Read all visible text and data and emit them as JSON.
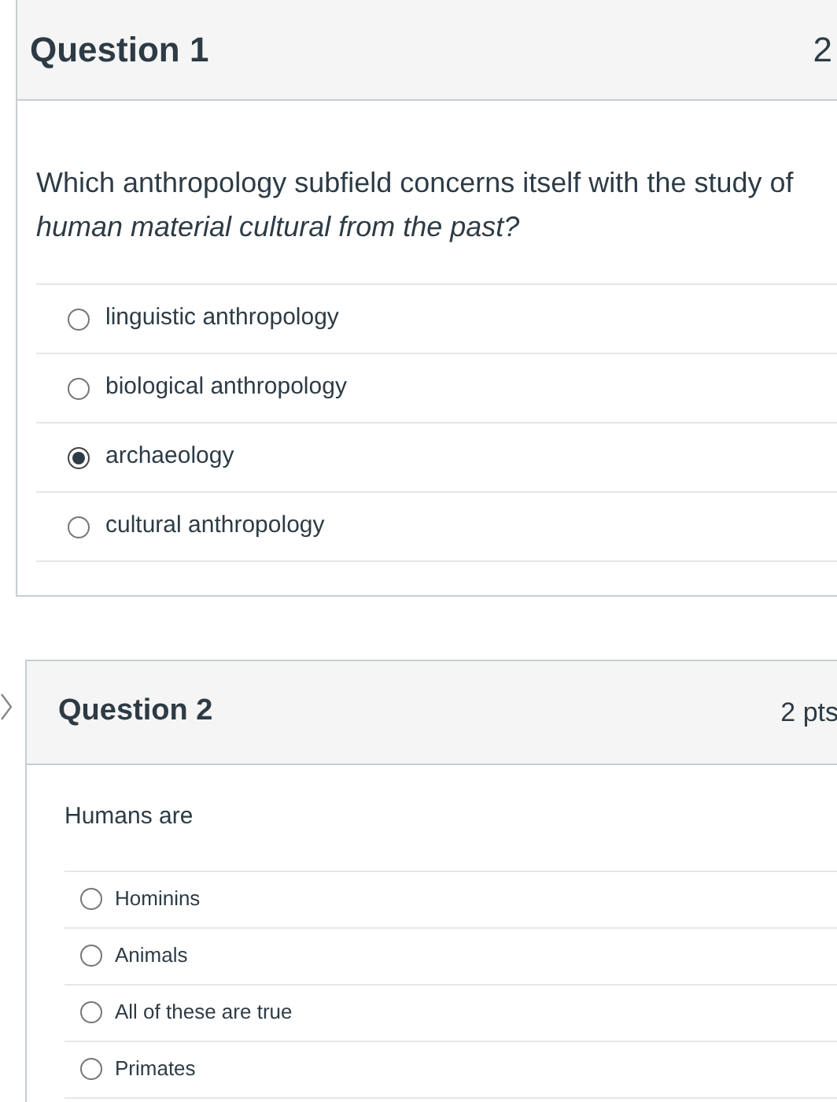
{
  "questions": [
    {
      "title": "Question 1",
      "points": "2",
      "prompt": "Which anthropology subfield concerns itself with the study of *human material cultural from the past?*",
      "options": [
        {
          "label": "linguistic anthropology",
          "selected": false
        },
        {
          "label": "biological anthropology",
          "selected": false
        },
        {
          "label": "archaeology",
          "selected": true
        },
        {
          "label": "cultural anthropology",
          "selected": false
        }
      ]
    },
    {
      "title": "Question 2",
      "points": "2 pts",
      "prompt": "Humans are",
      "options": [
        {
          "label": "Hominins",
          "selected": false
        },
        {
          "label": "Animals",
          "selected": false
        },
        {
          "label": "All of these are true",
          "selected": false
        },
        {
          "label": "Primates",
          "selected": false
        }
      ]
    }
  ]
}
